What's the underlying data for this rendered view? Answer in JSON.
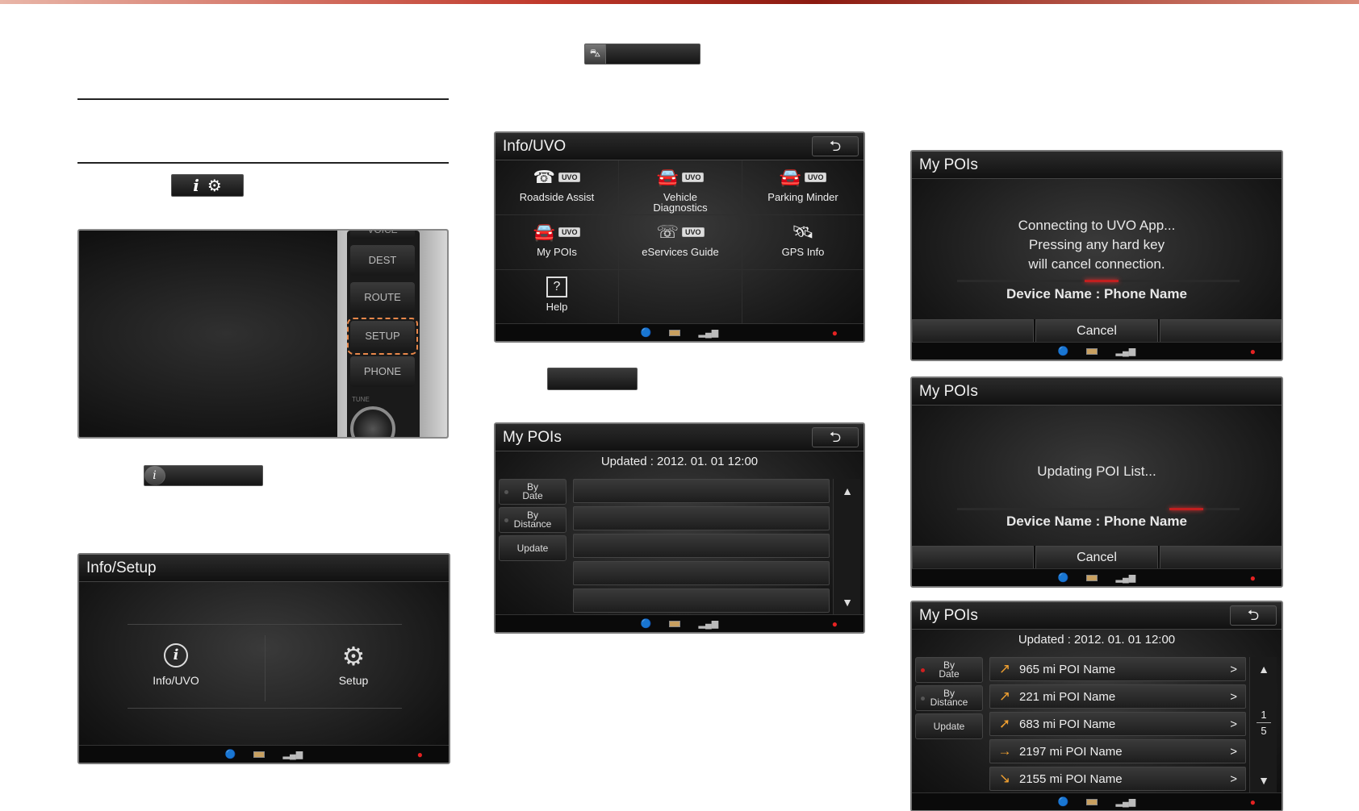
{
  "colors": {
    "accent_red": "#c21f1f",
    "screen_bg": "#161616",
    "chip_bg": "#151515"
  },
  "info_setup_key": {
    "icons": [
      "info-icon",
      "gear-icon"
    ]
  },
  "panel_buttons": [
    "DEST",
    "ROUTE",
    "SETUP",
    "PHONE"
  ],
  "panel_extra": {
    "top_label": "VOICE",
    "tune_label": "TUNE"
  },
  "info_setup_screen": {
    "title": "Info/Setup",
    "items": [
      {
        "label": "Info/UVO",
        "icon": "info-icon"
      },
      {
        "label": "Setup",
        "icon": "gear-icon"
      }
    ]
  },
  "info_uvo_screen": {
    "title": "Info/UVO",
    "back": "⮌",
    "badge": "UVO",
    "items": [
      {
        "label": "Roadside Assist",
        "icon": "roadside-icon",
        "uvo": true
      },
      {
        "label": "Vehicle\nDiagnostics",
        "icon": "vehicle-diagnostics-icon",
        "uvo": true
      },
      {
        "label": "Parking Minder",
        "icon": "parking-minder-icon",
        "uvo": true
      },
      {
        "label": "My POIs",
        "icon": "poi-car-icon",
        "uvo": true
      },
      {
        "label": "eServices Guide",
        "icon": "eservices-icon",
        "uvo": true
      },
      {
        "label": "GPS Info",
        "icon": "satellite-icon",
        "uvo": false
      },
      {
        "label": "Help",
        "icon": "help-icon",
        "uvo": false
      },
      {
        "label": "",
        "icon": "",
        "uvo": false
      },
      {
        "label": "",
        "icon": "",
        "uvo": false
      }
    ]
  },
  "my_pois_empty": {
    "title": "My POIs",
    "back": "⮌",
    "updated": "Updated : 2012. 01. 01 12:00",
    "side": [
      "By\nDate",
      "By\nDistance",
      "Update"
    ]
  },
  "connecting_screen": {
    "title": "My POIs",
    "line1": "Connecting to UVO App...",
    "line2": "Pressing any hard key",
    "line3": "will cancel connection.",
    "device": "Device Name : Phone Name",
    "cancel": "Cancel",
    "progress": 0.55
  },
  "updating_screen": {
    "title": "My POIs",
    "line1": "Updating POI List...",
    "device": "Device Name : Phone Name",
    "cancel": "Cancel",
    "progress": 0.85
  },
  "my_pois_list": {
    "title": "My POIs",
    "back": "⮌",
    "updated": "Updated : 2012. 01. 01 12:00",
    "side": [
      "By\nDate",
      "By\nDistance",
      "Update"
    ],
    "rows": [
      {
        "text": "965 mi POI Name",
        "arrow": "↗"
      },
      {
        "text": "221 mi POI Name",
        "arrow": "↗"
      },
      {
        "text": "683 mi POI Name",
        "arrow": "➚"
      },
      {
        "text": "2197 mi POI Name",
        "arrow": "→"
      },
      {
        "text": "2155 mi POI Name",
        "arrow": "↘"
      }
    ],
    "page_current": "1",
    "page_total": "5"
  },
  "status_bar": {
    "rec": "●"
  }
}
